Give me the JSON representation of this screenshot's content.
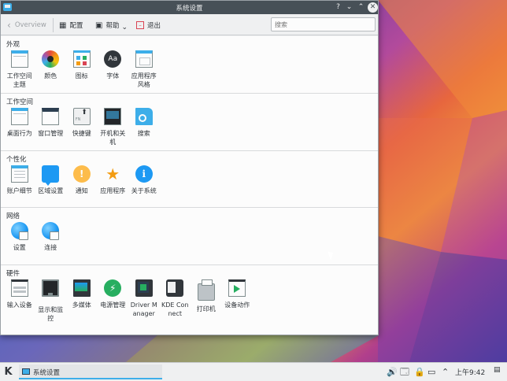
{
  "window": {
    "title": "系统设置",
    "buttons": {
      "help": "?",
      "minimize": "⌄",
      "maximize": "⌃",
      "close": "✕"
    }
  },
  "toolbar": {
    "back_label": "Overview",
    "configure_label": "配置",
    "help_label": "帮助",
    "quit_label": "退出",
    "search_placeholder": "搜索"
  },
  "sections": [
    {
      "title": "外观",
      "items": [
        {
          "label": "工作空间主题",
          "icon": "workspace-theme-icon"
        },
        {
          "label": "颜色",
          "icon": "colors-icon"
        },
        {
          "label": "图标",
          "icon": "icons-icon"
        },
        {
          "label": "字体",
          "icon": "fonts-icon",
          "glyph": "Aa"
        },
        {
          "label": "应用程序风格",
          "icon": "application-style-icon"
        }
      ]
    },
    {
      "title": "工作空间",
      "items": [
        {
          "label": "桌面行为",
          "icon": "desktop-behavior-icon"
        },
        {
          "label": "窗口管理",
          "icon": "window-management-icon"
        },
        {
          "label": "快捷键",
          "icon": "shortcuts-icon",
          "glyph": "FN"
        },
        {
          "label": "开机和关机",
          "icon": "startup-shutdown-icon"
        },
        {
          "label": "搜索",
          "icon": "search-icon"
        }
      ]
    },
    {
      "title": "个性化",
      "items": [
        {
          "label": "账户细节",
          "icon": "account-details-icon"
        },
        {
          "label": "区域设置",
          "icon": "regional-settings-icon"
        },
        {
          "label": "通知",
          "icon": "notifications-icon",
          "glyph": "!"
        },
        {
          "label": "应用程序",
          "icon": "applications-icon",
          "glyph": "★"
        },
        {
          "label": "关于系统",
          "icon": "about-system-icon",
          "glyph": "i"
        }
      ]
    },
    {
      "title": "网络",
      "items": [
        {
          "label": "设置",
          "icon": "network-settings-icon"
        },
        {
          "label": "连接",
          "icon": "connections-icon"
        }
      ]
    },
    {
      "title": "硬件",
      "items": [
        {
          "label": "输入设备",
          "icon": "input-devices-icon"
        },
        {
          "label": "显示和监控",
          "icon": "display-monitor-icon"
        },
        {
          "label": "多媒体",
          "icon": "multimedia-icon"
        },
        {
          "label": "电源管理",
          "icon": "power-management-icon",
          "glyph": "⚡"
        },
        {
          "label": "Driver Manager",
          "icon": "driver-manager-icon"
        },
        {
          "label": "KDE Connect",
          "icon": "kde-connect-icon"
        },
        {
          "label": "打印机",
          "icon": "printer-icon"
        },
        {
          "label": "设备动作",
          "icon": "device-actions-icon"
        }
      ]
    }
  ],
  "taskbar": {
    "launcher_glyph": "K",
    "task_label": "系统设置",
    "tray": [
      "🔊",
      "🗔",
      "🔒",
      "▭",
      "⌃"
    ],
    "clock": "上午9:42"
  },
  "colors": {
    "accent": "#3daee9",
    "titlebar": "#475057",
    "window_bg": "#eff0f1",
    "content_bg": "#fcfcfc"
  }
}
